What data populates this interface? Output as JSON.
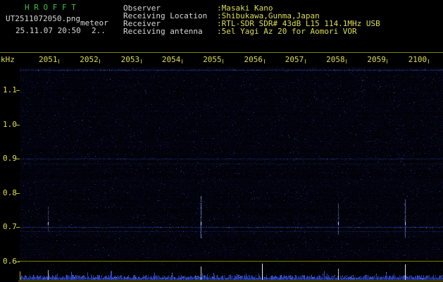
{
  "header": {
    "app_title": "H R O F F T",
    "filename": "UT2511072050.png",
    "observation_name": "meteor",
    "datetime": "25.11.07 20:50",
    "extra": "2..",
    "info_rows": [
      {
        "label": "Observer",
        "value": ":Masaki Kano"
      },
      {
        "label": "Receiving Location",
        "value": ":Shibukawa,Gunma,Japan"
      },
      {
        "label": "Receiver",
        "value": ":RTL-SDR SDR# 43dB L15 114.1MHz USB"
      },
      {
        "label": "Receiving antenna",
        "value": ":5el Yagi Az 20 for Aomori VOR"
      }
    ]
  },
  "colors": {
    "title_green": "#3cc23c",
    "text_white": "#d8d8d8",
    "text_yellow": "#dede52",
    "axis_yellow": "#b8b818",
    "line_yellow": "#7f7f00",
    "noise_blue": "#3c5ae6",
    "echo_blue": "#8aa2ff",
    "background": "#000000"
  },
  "chart_data": {
    "type": "heatmap",
    "title": "HROFFT meteor radio spectrogram, 10-minute window 20:50-21:00 UT",
    "x_axis": {
      "ticks": [
        "2051",
        "2052",
        "2053",
        "2054",
        "2055",
        "2056",
        "2057",
        "2058",
        "2059",
        "2100"
      ]
    },
    "y_axis": {
      "label": "kHz",
      "ticks": [
        "1.1",
        "1.0",
        "0.9",
        "0.8",
        "0.7",
        "0.6"
      ],
      "range_khz": [
        0.6,
        1.17
      ]
    },
    "carrier_bands": [
      {
        "freq_khz": 1.16,
        "strength": 0.5
      },
      {
        "freq_khz": 0.9,
        "strength": 0.3
      },
      {
        "freq_khz": 0.885,
        "strength": 0.16
      },
      {
        "freq_khz": 0.7,
        "strength": 0.5
      },
      {
        "freq_khz": 0.688,
        "strength": 0.2
      }
    ],
    "meteor_echoes": [
      {
        "time": "20:50:40",
        "x_frac": 0.067,
        "freq_top_khz": 0.76,
        "freq_bottom_khz": 0.69,
        "strength": 0.45
      },
      {
        "time": "20:54:17",
        "x_frac": 0.428,
        "freq_top_khz": 0.79,
        "freq_bottom_khz": 0.67,
        "strength": 1.0
      },
      {
        "time": "20:57:31",
        "x_frac": 0.752,
        "freq_top_khz": 0.77,
        "freq_bottom_khz": 0.68,
        "strength": 0.6
      },
      {
        "time": "20:59:06",
        "x_frac": 0.91,
        "freq_top_khz": 0.78,
        "freq_bottom_khz": 0.67,
        "strength": 0.8
      }
    ],
    "level_peaks": [
      {
        "x_frac": 0.067,
        "strength": 0.4
      },
      {
        "x_frac": 0.428,
        "strength": 0.7
      },
      {
        "x_frac": 0.572,
        "strength": 1.0
      },
      {
        "x_frac": 0.752,
        "strength": 0.5
      },
      {
        "x_frac": 0.91,
        "strength": 0.9
      }
    ]
  }
}
